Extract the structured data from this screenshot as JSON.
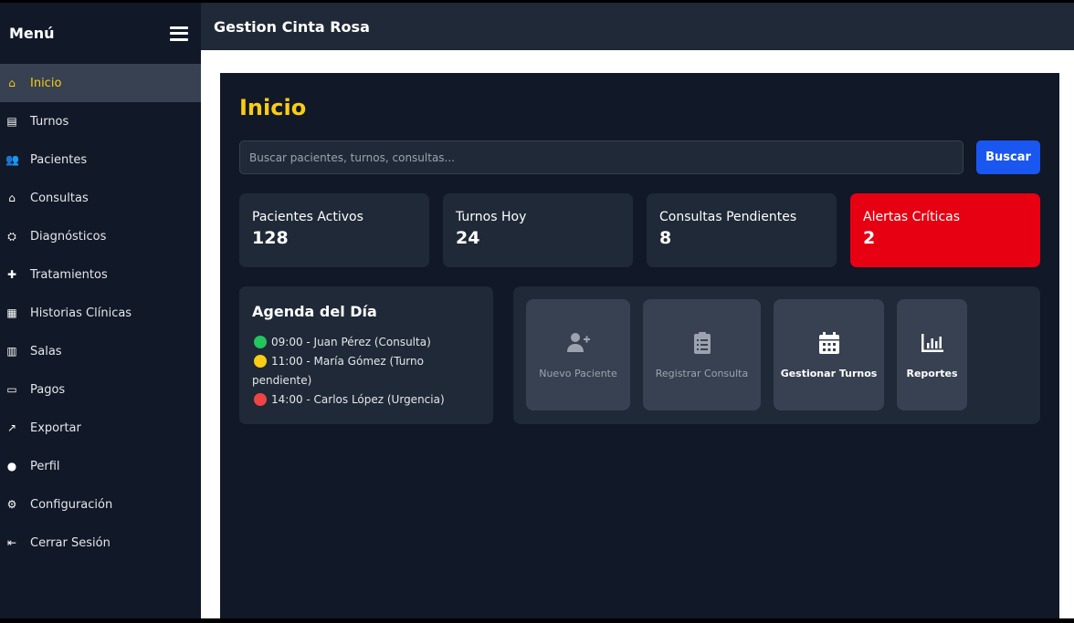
{
  "sidebar": {
    "title": "Menú",
    "items": [
      {
        "label": "Inicio",
        "icon": "home-icon",
        "glyph": "⌂",
        "active": true
      },
      {
        "label": "Turnos",
        "icon": "address-book-icon",
        "glyph": "▤"
      },
      {
        "label": "Pacientes",
        "icon": "users-icon",
        "glyph": "👥"
      },
      {
        "label": "Consultas",
        "icon": "clinic-house-icon",
        "glyph": "⌂"
      },
      {
        "label": "Diagnósticos",
        "icon": "diagnosis-icon",
        "glyph": "⛭"
      },
      {
        "label": "Tratamientos",
        "icon": "plus-icon",
        "glyph": "✚"
      },
      {
        "label": "Historias Clínicas",
        "icon": "file-medical-icon",
        "glyph": "▦"
      },
      {
        "label": "Salas",
        "icon": "building-icon",
        "glyph": "▥"
      },
      {
        "label": "Pagos",
        "icon": "credit-card-icon",
        "glyph": "▭"
      },
      {
        "label": "Exportar",
        "icon": "external-link-icon",
        "glyph": "↗"
      },
      {
        "label": "Perfil",
        "icon": "user-icon",
        "glyph": "●"
      },
      {
        "label": "Configuración",
        "icon": "gear-icon",
        "glyph": "⚙"
      },
      {
        "label": "Cerrar Sesión",
        "icon": "sign-out-icon",
        "glyph": "⇤"
      }
    ]
  },
  "header": {
    "title": "Gestion Cinta Rosa"
  },
  "main": {
    "title": "Inicio",
    "search": {
      "placeholder": "Buscar pacientes, turnos, consultas...",
      "value": "",
      "button": "Buscar"
    },
    "stats": [
      {
        "label": "Pacientes Activos",
        "value": "128"
      },
      {
        "label": "Turnos Hoy",
        "value": "24"
      },
      {
        "label": "Consultas Pendientes",
        "value": "8"
      },
      {
        "label": "Alertas Críticas",
        "value": "2",
        "color": "#e60012"
      }
    ],
    "agenda": {
      "title": "Agenda del Día",
      "items": [
        {
          "text": "09:00 - Juan Pérez (Consulta)",
          "color": "#22c55e"
        },
        {
          "text": "11:00 - María Gómez (Turno pendiente)",
          "color": "#facc15"
        },
        {
          "text": "14:00 - Carlos López (Urgencia)",
          "color": "#ef4444"
        }
      ]
    },
    "actions": [
      {
        "label": "Nuevo Paciente",
        "icon": "user-plus-icon"
      },
      {
        "label": "Registrar Consulta",
        "icon": "clipboard-list-icon"
      },
      {
        "label": "Gestionar Turnos",
        "icon": "calendar-icon"
      },
      {
        "label": "Reportes",
        "icon": "bar-chart-icon"
      }
    ]
  },
  "colors": {
    "accent": "#facc15",
    "primary": "#1a56f0",
    "critical": "#e60012"
  }
}
